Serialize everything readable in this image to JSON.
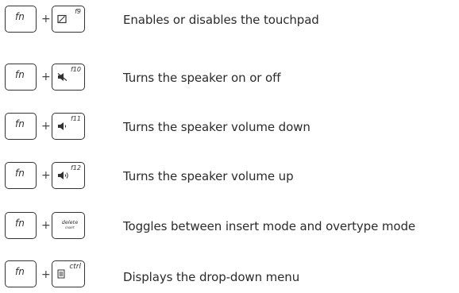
{
  "shortcuts": [
    {
      "modifier": "fn",
      "plus": "+",
      "key_label": "f9",
      "key_icon": "touchpad-icon",
      "description": "Enables or disables the touchpad"
    },
    {
      "modifier": "fn",
      "plus": "+",
      "key_label": "f10",
      "key_icon": "speaker-mute-icon",
      "description": "Turns the speaker on or off"
    },
    {
      "modifier": "fn",
      "plus": "+",
      "key_label": "f11",
      "key_icon": "volume-down-icon",
      "description": "Turns the speaker volume down"
    },
    {
      "modifier": "fn",
      "plus": "+",
      "key_label": "f12",
      "key_icon": "volume-up-icon",
      "description": "Turns the speaker volume up"
    },
    {
      "modifier": "fn",
      "plus": "+",
      "key_label": "delete",
      "key_sublabel": "insert",
      "description": "Toggles between insert mode and overtype mode"
    },
    {
      "modifier": "fn",
      "plus": "+",
      "key_label": "ctrl",
      "key_icon": "menu-icon",
      "description": "Displays the drop-down menu"
    }
  ]
}
